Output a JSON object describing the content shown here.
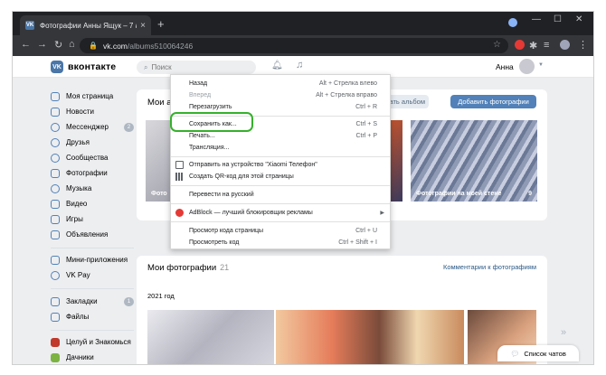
{
  "browser": {
    "tab_title": "Фотографии Анны Ящук – 7 ал",
    "tab_favicon": "VK",
    "url_host": "vk.com",
    "url_path": "/albums510064246"
  },
  "header": {
    "logo_text": "VK",
    "site_name": "вконтакте",
    "search_placeholder": "Поиск",
    "user_name": "Анна"
  },
  "sidebar": {
    "items": [
      {
        "label": "Моя страница",
        "icon": "user-icon"
      },
      {
        "label": "Новости",
        "icon": "news-icon"
      },
      {
        "label": "Мессенджер",
        "icon": "message-icon",
        "count": "2"
      },
      {
        "label": "Друзья",
        "icon": "friends-icon"
      },
      {
        "label": "Сообщества",
        "icon": "groups-icon"
      },
      {
        "label": "Фотографии",
        "icon": "photo-icon"
      },
      {
        "label": "Музыка",
        "icon": "music-icon"
      },
      {
        "label": "Видео",
        "icon": "video-icon"
      },
      {
        "label": "Игры",
        "icon": "games-icon"
      },
      {
        "label": "Объявления",
        "icon": "ads-icon"
      }
    ],
    "items2": [
      {
        "label": "Мини-приложения",
        "icon": "apps-icon"
      },
      {
        "label": "VK Pay",
        "icon": "pay-icon"
      }
    ],
    "items3": [
      {
        "label": "Закладки",
        "icon": "bookmark-icon",
        "count": "1"
      },
      {
        "label": "Файлы",
        "icon": "file-icon"
      }
    ],
    "items4": [
      {
        "label": "Целуй и Знакомься",
        "icon": "app-icon"
      },
      {
        "label": "Дачники",
        "icon": "app-icon"
      }
    ]
  },
  "albums": {
    "title": "Мои а",
    "create_label": "здать альбом",
    "add_label": "Добавить фотографии",
    "cards": [
      {
        "caption": "Фото",
        "count": ""
      },
      {
        "caption": "",
        "count": ""
      },
      {
        "caption": "Фотографии на моей стене",
        "count": "9"
      }
    ]
  },
  "photos": {
    "title": "Мои фотографии",
    "count": "21",
    "comments_link": "Комментарии к фотографиям",
    "year": "2021 год"
  },
  "chat": {
    "label": "Список чатов"
  },
  "context_menu": {
    "items": [
      {
        "label": "Назад",
        "shortcut": "Alt + Стрелка влево"
      },
      {
        "label": "Вперед",
        "shortcut": "Alt + Стрелка вправо",
        "disabled": true
      },
      {
        "label": "Перезагрузить",
        "shortcut": "Ctrl + R"
      },
      {
        "label": "Сохранить как...",
        "shortcut": "Ctrl + S"
      },
      {
        "label": "Печать...",
        "shortcut": "Ctrl + P"
      },
      {
        "label": "Трансляция..."
      },
      {
        "label": "Отправить на устройство \"Xiaomi Телефон\"",
        "icon": "device-icon"
      },
      {
        "label": "Создать QR-код для этой страницы",
        "icon": "qr-icon"
      },
      {
        "label": "Перевести на русский"
      },
      {
        "label": "AdBlock — лучший блокировщик рекламы",
        "icon": "adblock-icon"
      },
      {
        "label": "Просмотр кода страницы",
        "shortcut": "Ctrl + U"
      },
      {
        "label": "Просмотреть код",
        "shortcut": "Ctrl + Shift + I"
      }
    ]
  },
  "colors": {
    "vk_blue": "#5181b8",
    "highlight": "#37b02c"
  }
}
